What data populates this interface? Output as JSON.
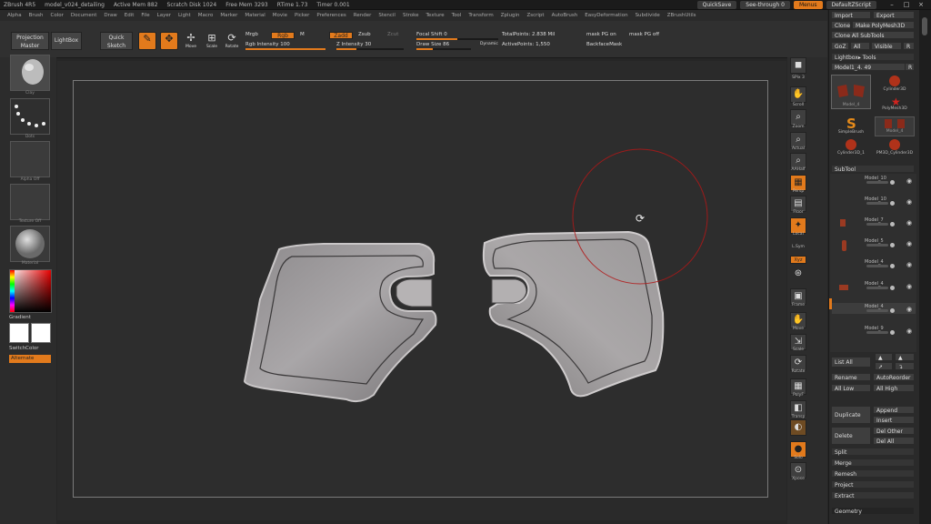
{
  "titlebar": {
    "app": "ZBrush 4R5",
    "file": "model_v024_detailing",
    "active_mem": "Active Mem 882",
    "scratch_disk": "Scratch Disk 1024",
    "free_mem": "Free Mem 3293",
    "rtime": "RTime 1.73",
    "timer": "Timer 0.001",
    "quicksave": "QuickSave",
    "seethrough": "See-through 0",
    "menus": "Menus",
    "defaultzscript": "DefaultZScript"
  },
  "menubar": [
    "Alpha",
    "Brush",
    "Color",
    "Document",
    "Draw",
    "Edit",
    "File",
    "Layer",
    "Light",
    "Macro",
    "Marker",
    "Material",
    "Movie",
    "Picker",
    "Preferences",
    "Render",
    "Stencil",
    "Stroke",
    "Texture",
    "Tool",
    "Transform",
    "Zplugin",
    "Zscript",
    "AutoBrush",
    "EasyDeformation",
    "Subdivide",
    "ZBrushUtils"
  ],
  "shelf": {
    "projection_master": "Projection Master",
    "lightbox": "LightBox",
    "quick_sketch": "Quick Sketch",
    "edit": "Edit",
    "draw": "Draw",
    "move": "Move",
    "scale": "Scale",
    "rotate": "Rotate",
    "mrgb": "Mrgb",
    "rgb": "Rgb",
    "m": "M",
    "rgb_intensity": "Rgb Intensity 100",
    "zadd": "Zadd",
    "zsub": "Zsub",
    "zcut": "Zcut",
    "z_intensity": "Z Intensity 30",
    "focal_shift": "Focal Shift 0",
    "draw_size": "Draw Size 86",
    "dynamic": "Dynamic",
    "total_points": "TotalPoints: 2.838 Mil",
    "active_points": "ActivePoints: 1,550",
    "mask_pg_on": "mask PG on",
    "mask_pg_off": "mask PG off",
    "backface_mask": "BackfaceMask"
  },
  "lefttray": {
    "brush_lbl": "Clay",
    "stroke_lbl": "Dots",
    "alpha_lbl": "Alpha Off",
    "texture_lbl": "Texture Off",
    "material_lbl": "Material",
    "gradient": "Gradient",
    "switchcolor": "SwitchColor",
    "alternate": "Alternate"
  },
  "rightshelf": [
    "SPix 3",
    "Scroll",
    "Zoom",
    "Actual",
    "AAHalf",
    "Persp",
    "Floor",
    "Local",
    "L.Sym",
    "Xyz",
    "Frame",
    "Move",
    "Scale",
    "Rotate",
    "PolyF",
    "Transp",
    "Solo",
    "Xpose"
  ],
  "rightpal": {
    "import": "Import",
    "export": "Export",
    "clone": "Clone",
    "make_polymesh": "Make PolyMesh3D",
    "clone_all": "Clone All SubTools",
    "goz": "GoZ",
    "all": "All",
    "visible": "Visible",
    "r": "R",
    "lightbox_tools": "Lightbox▸ Tools",
    "current_tool": "Model1_4. 49",
    "tools": [
      "Model_4",
      "Cylinder3D",
      "PolyMesh3D",
      "SimpleBrush",
      "Model_4",
      "Cylinder3D_1",
      "PM3D_Cylinder3D"
    ],
    "subtool": "SubTool",
    "subtools": [
      "Model_10",
      "Model_10",
      "Model_7",
      "Model_5",
      "Model_4",
      "Model_4",
      "Model_4",
      "Model_9"
    ],
    "list_all": "List All",
    "rename": "Rename",
    "autoreorder": "AutoReorder",
    "all_low": "All Low",
    "all_high": "All High",
    "duplicate": "Duplicate",
    "append": "Append",
    "insert": "Insert",
    "delete": "Delete",
    "del_other": "Del Other",
    "del_all": "Del All",
    "split": "Split",
    "merge": "Merge",
    "remesh": "Remesh",
    "project": "Project",
    "extract": "Extract",
    "geometry": "Geometry"
  }
}
